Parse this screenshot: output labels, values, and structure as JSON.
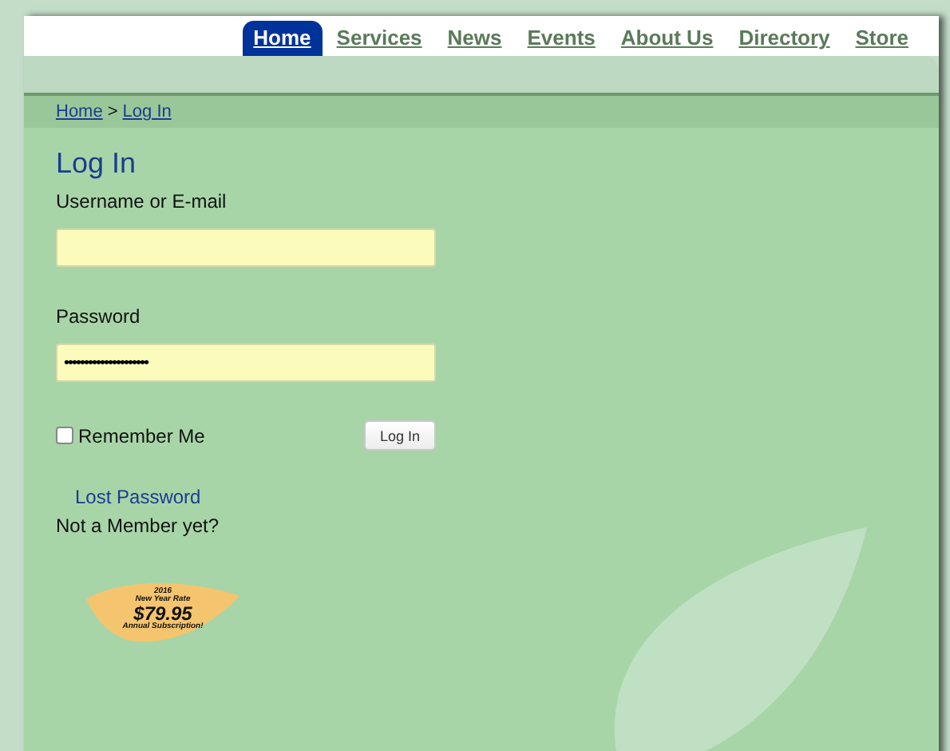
{
  "nav": [
    {
      "label": "Home",
      "selected": true
    },
    {
      "label": "Services",
      "selected": false
    },
    {
      "label": "News",
      "selected": false
    },
    {
      "label": "Events",
      "selected": false
    },
    {
      "label": "About Us",
      "selected": false
    },
    {
      "label": "Directory",
      "selected": false
    },
    {
      "label": "Store",
      "selected": false
    }
  ],
  "breadcrumb": {
    "links": [
      "Home",
      "Log In"
    ],
    "separator": ">"
  },
  "title": "Log In",
  "fields": [
    {
      "label": "Username or E-mail"
    },
    {
      "label": "Password",
      "value": "•••••••••••••••••••••"
    }
  ],
  "remember": {
    "label": "Remember Me",
    "checked": false
  },
  "submit": "Log In",
  "lost_password": "Lost Password",
  "not_member": "Not a Member yet?",
  "promo": {
    "year": "2016",
    "line": "New Year Rate",
    "price": "$79.95",
    "note": "Annual Subscription!"
  }
}
